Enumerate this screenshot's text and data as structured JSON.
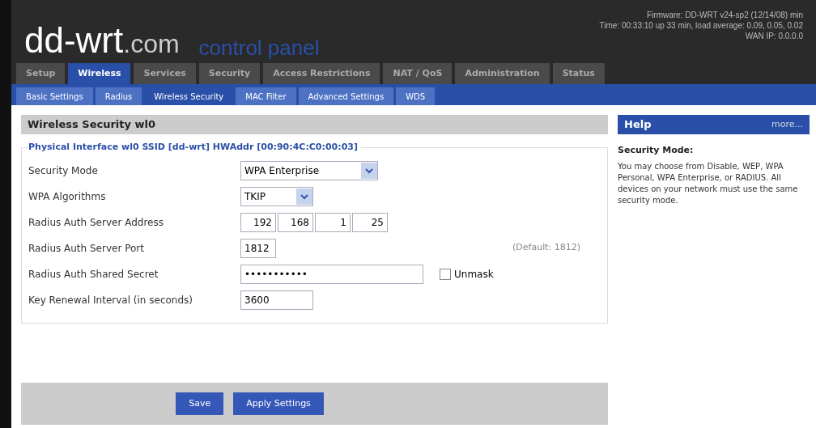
{
  "header": {
    "logo": "dd-wrt",
    "logo_suffix": ".com",
    "subtitle": "control panel",
    "info": [
      "Firmware: DD-WRT v24-sp2 (12/14/08) min",
      "Time: 00:33:10 up 33 min, load average: 0.09, 0.05, 0.02",
      "WAN IP: 0.0.0.0"
    ]
  },
  "tabs": [
    {
      "label": "Setup",
      "selected": false
    },
    {
      "label": "Wireless",
      "selected": true
    },
    {
      "label": "Services",
      "selected": false
    },
    {
      "label": "Security",
      "selected": false
    },
    {
      "label": "Access Restrictions",
      "selected": false
    },
    {
      "label": "NAT / QoS",
      "selected": false
    },
    {
      "label": "Administration",
      "selected": false
    },
    {
      "label": "Status",
      "selected": false
    }
  ],
  "subtabs": [
    {
      "label": "Basic Settings",
      "selected": false
    },
    {
      "label": "Radius",
      "selected": false
    },
    {
      "label": "Wireless Security",
      "selected": true
    },
    {
      "label": "MAC Filter",
      "selected": false
    },
    {
      "label": "Advanced Settings",
      "selected": false
    },
    {
      "label": "WDS",
      "selected": false
    }
  ],
  "section": {
    "title": "Wireless Security wl0",
    "legend": "Physical Interface wl0 SSID [dd-wrt] HWAddr [00:90:4C:C0:00:03]",
    "rows": [
      {
        "kind": "select",
        "label": "Security Mode",
        "value": "WPA Enterprise",
        "wide": true
      },
      {
        "kind": "select",
        "label": "WPA Algorithms",
        "value": "TKIP",
        "wide": false
      },
      {
        "kind": "ip",
        "label": "Radius Auth Server Address",
        "octets": [
          "192",
          "168",
          "1",
          "25"
        ]
      },
      {
        "kind": "port",
        "label": "Radius Auth Server Port",
        "value": "1812",
        "hint": "(Default: 1812)"
      },
      {
        "kind": "secret",
        "label": "Radius Auth Shared Secret",
        "value": "•••••••••••",
        "checkbox_label": "Unmask",
        "checked": false
      },
      {
        "kind": "text",
        "label": "Key Renewal Interval (in seconds)",
        "value": "3600"
      }
    ]
  },
  "buttons": [
    "Save",
    "Apply Settings"
  ],
  "help": {
    "title": "Help",
    "more": "more...",
    "heading": "Security Mode:",
    "text": "You may choose from Disable, WEP, WPA Personal, WPA Enterprise, or RADIUS. All devices on your network must use the same security mode."
  }
}
